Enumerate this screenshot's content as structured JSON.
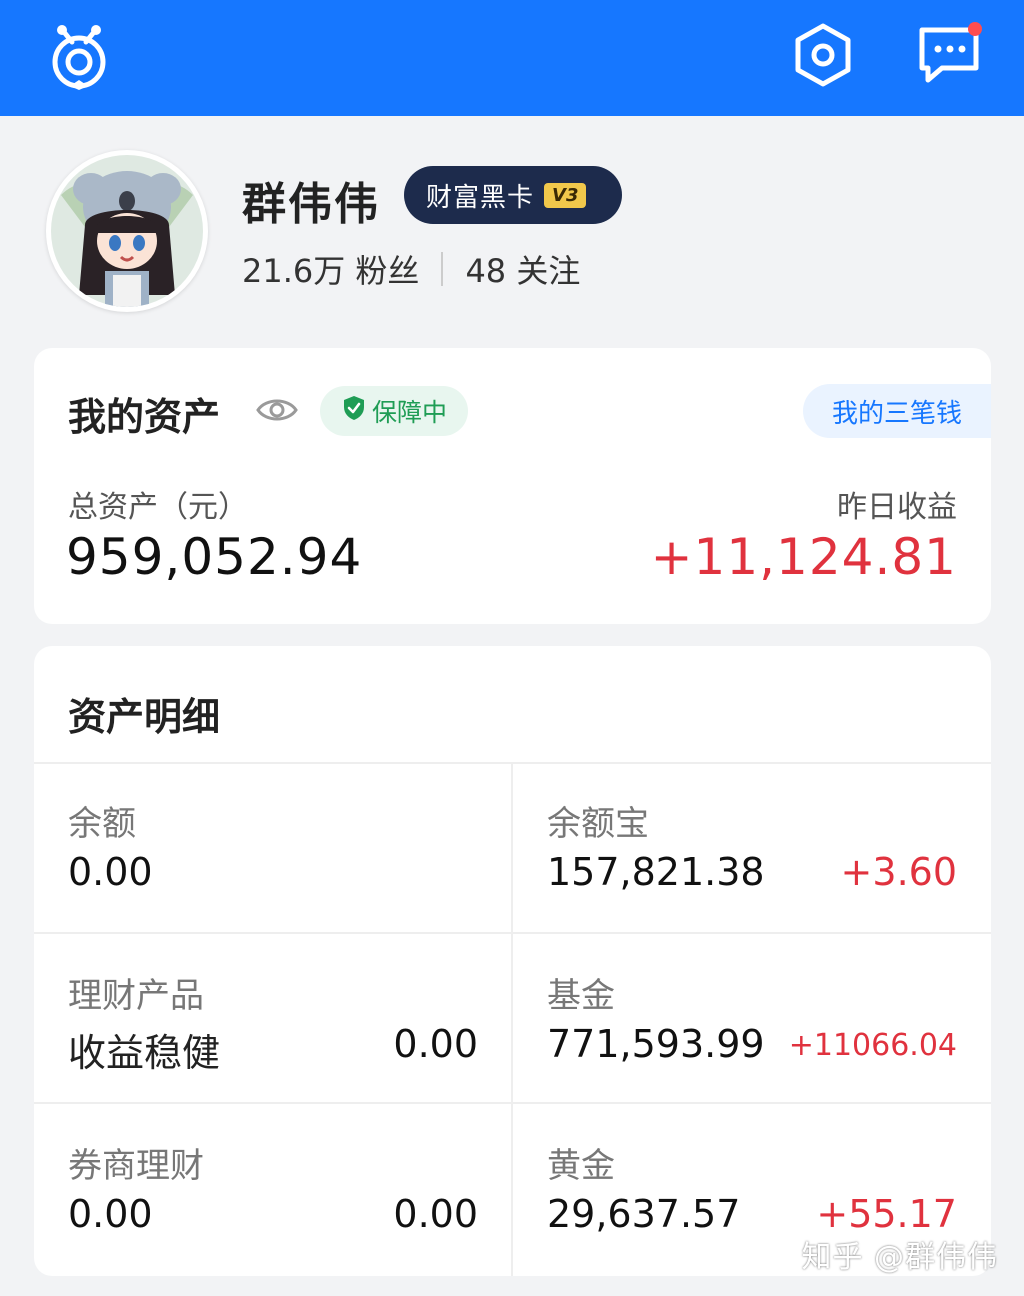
{
  "header": {
    "bg_color": "#1677ff",
    "logo_icon": "bee-logo-icon",
    "settings_icon": "hexagon-settings-icon",
    "message_icon": "message-bubble-icon"
  },
  "profile": {
    "name": "群伟伟",
    "vip_label": "财富黑卡",
    "vip_level": "V3",
    "fans": "21.6万 粉丝",
    "following": "48 关注"
  },
  "assets": {
    "title": "我的资产",
    "protect_label": "保障中",
    "three_money_label": "我的三笔钱",
    "total_label": "总资产（元）",
    "total_value": "959,052.94",
    "yesterday_label": "昨日收益",
    "yesterday_value": "+11,124.81"
  },
  "detail": {
    "title": "资产明细",
    "cells": [
      {
        "label": "余额",
        "value": "0.00",
        "right": "",
        "gain": ""
      },
      {
        "label": "余额宝",
        "value": "157,821.38",
        "right": "",
        "gain": "+3.60"
      },
      {
        "label": "理财产品",
        "value": "收益稳健",
        "right": "0.00",
        "gain": ""
      },
      {
        "label": "基金",
        "value": "771,593.99",
        "right": "",
        "gain": "+11066.04"
      },
      {
        "label": "券商理财",
        "value": "0.00",
        "right": "0.00",
        "gain": ""
      },
      {
        "label": "黄金",
        "value": "29,637.57",
        "right": "",
        "gain": "+55.17"
      }
    ]
  },
  "watermark": "知乎 @群伟伟",
  "colors": {
    "accent": "#1677ff",
    "gain_red": "#e0323e",
    "protect_green": "#1f9d55"
  }
}
